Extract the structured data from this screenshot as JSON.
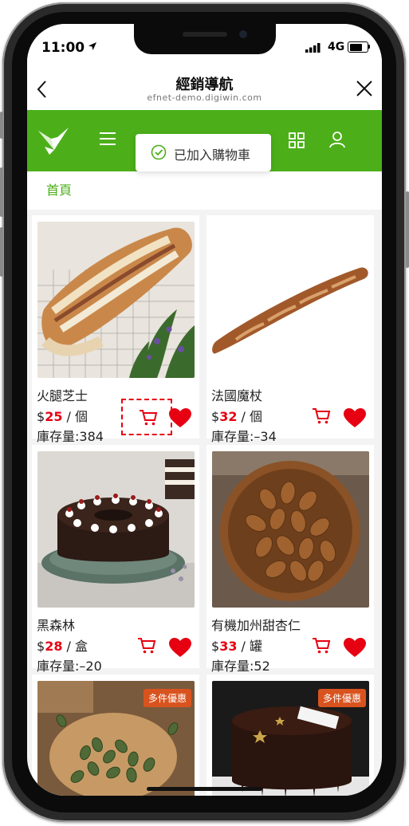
{
  "status_bar": {
    "time": "11:00",
    "network": "4G"
  },
  "titlebar": {
    "title": "經銷導航",
    "subtitle": "efnet-demo.digiwin.com"
  },
  "toast": {
    "message": "已加入購物車"
  },
  "breadcrumb": {
    "home": "首頁"
  },
  "colors": {
    "brand_green": "#4caf1a",
    "price_red": "#e60012",
    "badge_orange": "#d9531e"
  },
  "products": [
    {
      "name": "火腿芝士",
      "currency": "$",
      "price": "25",
      "unit": "/ 個",
      "stock": "庫存量:384"
    },
    {
      "name": "法國魔杖",
      "currency": "$",
      "price": "32",
      "unit": "/ 個",
      "stock": "庫存量:–34"
    },
    {
      "name": "黑森林",
      "currency": "$",
      "price": "28",
      "unit": "/ 盒",
      "stock": "庫存量:–20"
    },
    {
      "name": "有機加州甜杏仁",
      "currency": "$",
      "price": "33",
      "unit": "/ 罐",
      "stock": "庫存量:52"
    },
    {
      "badge": "多件優惠"
    },
    {
      "badge": "多件優惠"
    }
  ],
  "icons": [
    "back-icon",
    "close-icon",
    "menu-icon",
    "grid-icon",
    "user-icon",
    "cart-icon",
    "heart-icon",
    "check-circle-icon"
  ]
}
